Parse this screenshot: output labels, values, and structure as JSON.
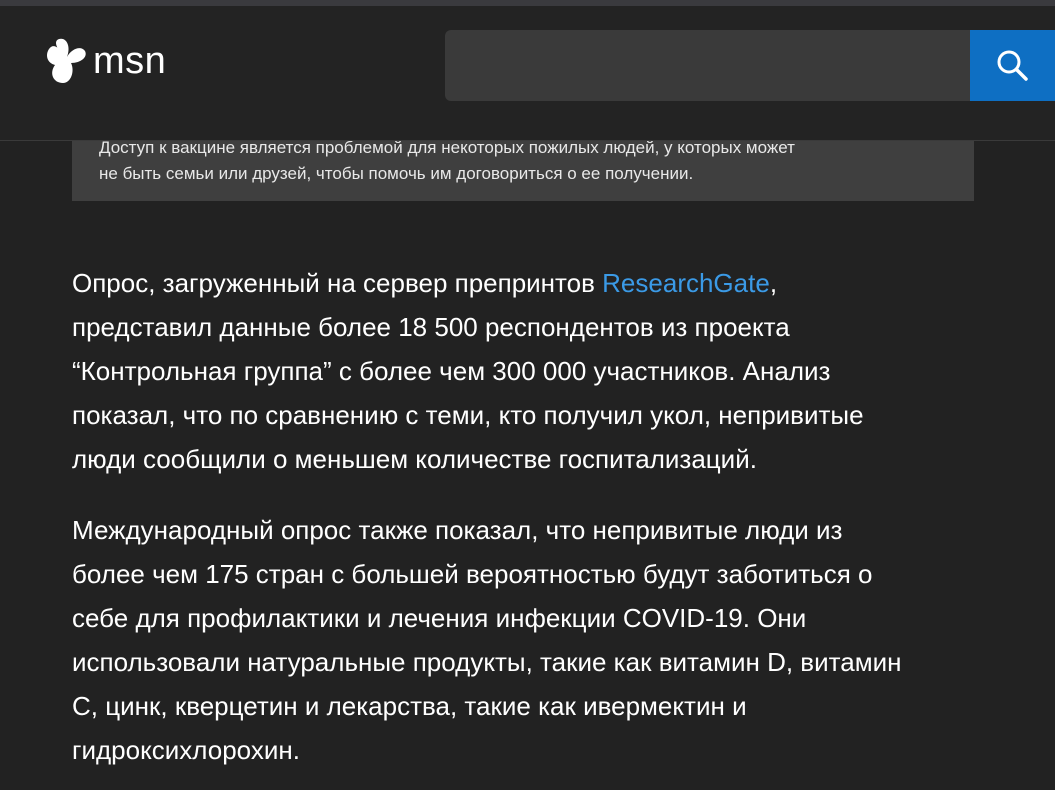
{
  "header": {
    "logo_text": "msn",
    "search": {
      "value": "",
      "placeholder": ""
    }
  },
  "article": {
    "caption": {
      "line1": "Доступ к вакцине является проблемой для некоторых пожилых людей, у которых может",
      "line2": "не быть семьи или друзей, чтобы помочь им договориться о ее получении."
    },
    "paragraph1": {
      "line1_before_link": "Опрос, загруженный на сервер препринтов ",
      "link_text": "ResearchGate",
      "line1_after_link": ",",
      "line2": "представил данные более 18 500 респондентов из проекта",
      "line3": "“Контрольная группа” с более чем 300 000 участников. Анализ",
      "line4": "показал, что по сравнению с теми, кто получил укол, непривитые",
      "line5": "люди сообщили о меньшем количестве госпитализаций."
    },
    "paragraph2": {
      "line1": "Международный опрос также показал, что непривитые люди из",
      "line2": "более чем 175 стран с большей вероятностью будут заботиться о",
      "line3": "себе для профилактики и лечения инфекции COVID-19. Они",
      "line4": "использовали натуральные продукты, такие как витамин D, витамин",
      "line5": "C, цинк, кверцетин и лекарства, такие как ивермектин и",
      "line6": "гидроксихлорохин."
    }
  },
  "icons": {
    "logo": "msn-butterfly-icon",
    "search": "search-icon"
  },
  "colors": {
    "background": "#222222",
    "header_background": "#232323",
    "caption_background": "#3f3f3f",
    "search_field": "#3a3a3a",
    "search_button": "#0e6fc3",
    "link": "#3b9ae6",
    "text": "#ffffff"
  }
}
